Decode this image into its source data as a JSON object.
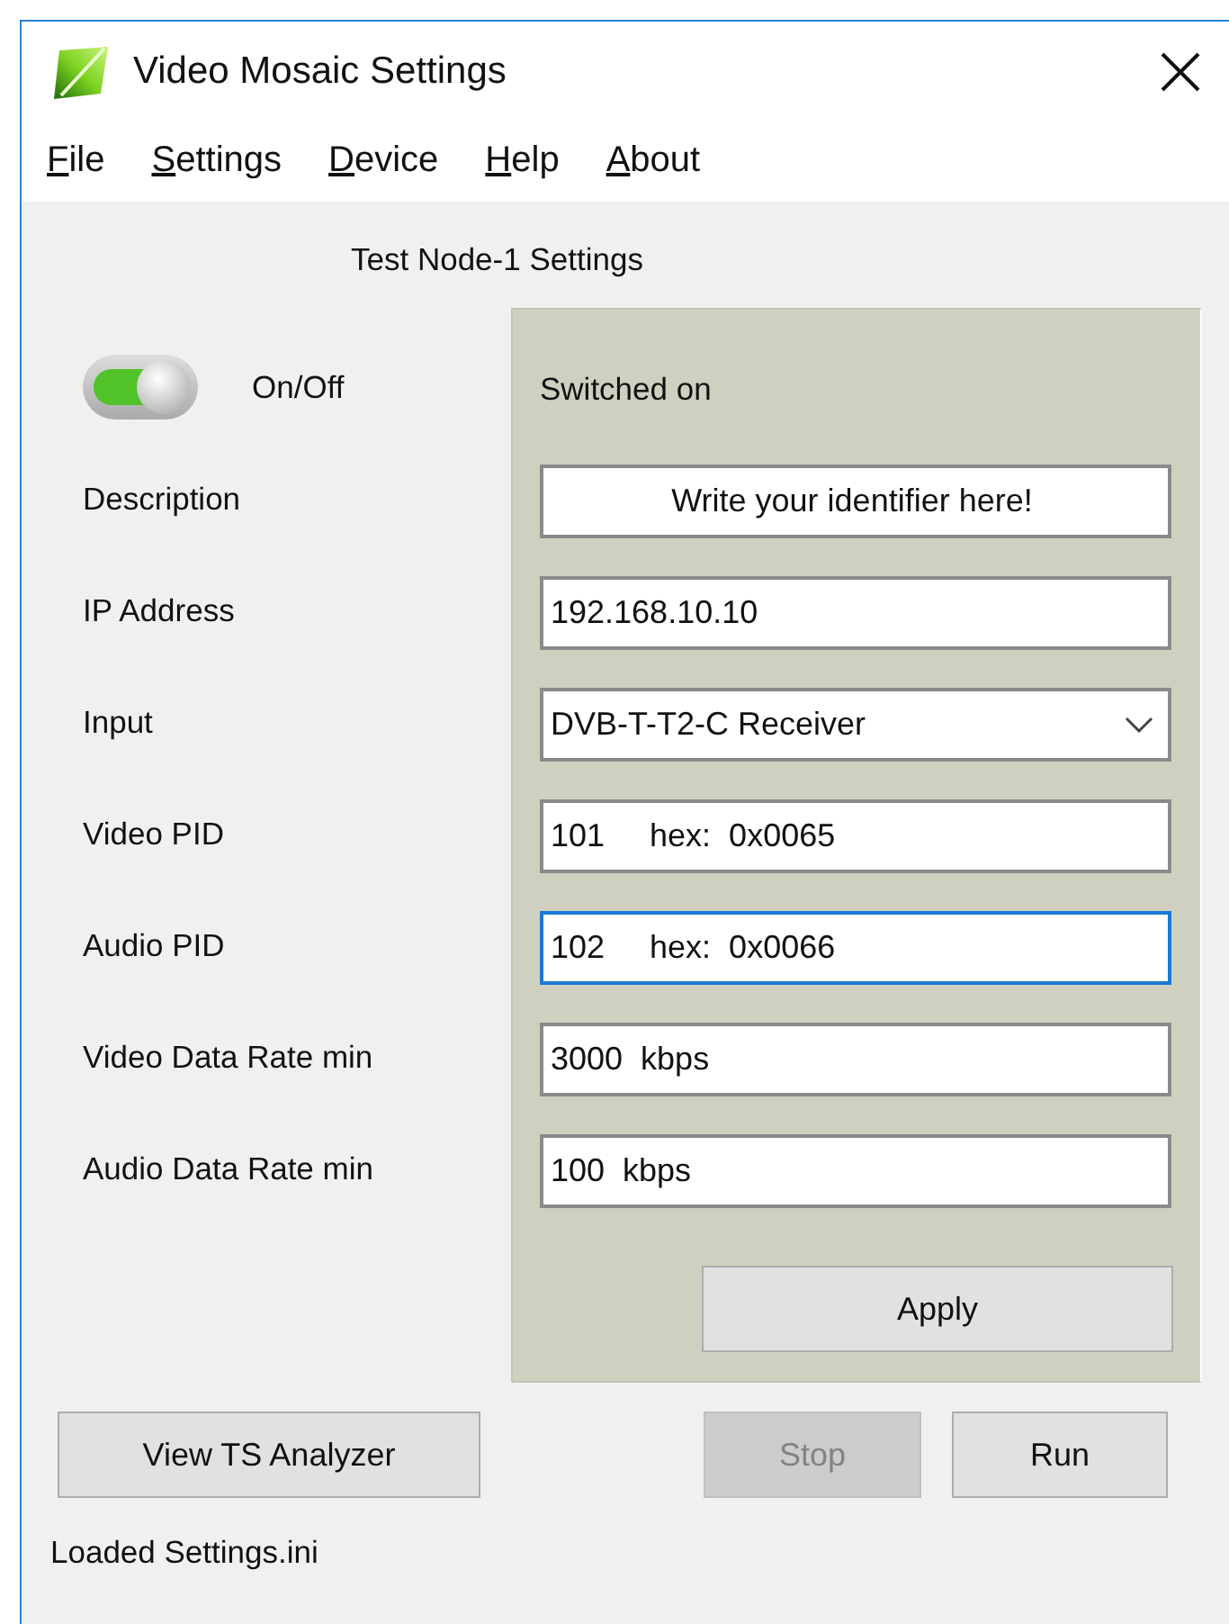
{
  "window": {
    "title": "Video Mosaic Settings"
  },
  "menu": [
    {
      "label": "File"
    },
    {
      "label": "Settings"
    },
    {
      "label": "Device"
    },
    {
      "label": "Help"
    },
    {
      "label": "About"
    }
  ],
  "heading": "Test Node-1 Settings",
  "power": {
    "label": "On/Off",
    "on": true,
    "status": "Switched on"
  },
  "fields": [
    {
      "label": "Description",
      "kind": "centered",
      "value": "Write your identifier here!",
      "focused": false
    },
    {
      "label": "IP Address",
      "kind": "text",
      "value": "192.168.10.10",
      "focused": false
    },
    {
      "label": "Input",
      "kind": "select",
      "value": "DVB-T-T2-C Receiver",
      "focused": false
    },
    {
      "label": "Video PID",
      "kind": "text",
      "value": "101     hex:  0x0065",
      "focused": false
    },
    {
      "label": "Audio PID",
      "kind": "text",
      "value": "102     hex:  0x0066",
      "focused": true
    },
    {
      "label": "Video Data Rate min",
      "kind": "text",
      "value": "3000  kbps",
      "focused": false
    },
    {
      "label": "Audio Data Rate min",
      "kind": "text",
      "value": "100  kbps",
      "focused": false
    }
  ],
  "apply_button": "Apply",
  "buttons": [
    {
      "label": "View TS Analyzer",
      "disabled": false
    },
    {
      "label": "Stop",
      "disabled": true
    },
    {
      "label": "Run",
      "disabled": false
    }
  ],
  "status_bar": "Loaded Settings.ini"
}
